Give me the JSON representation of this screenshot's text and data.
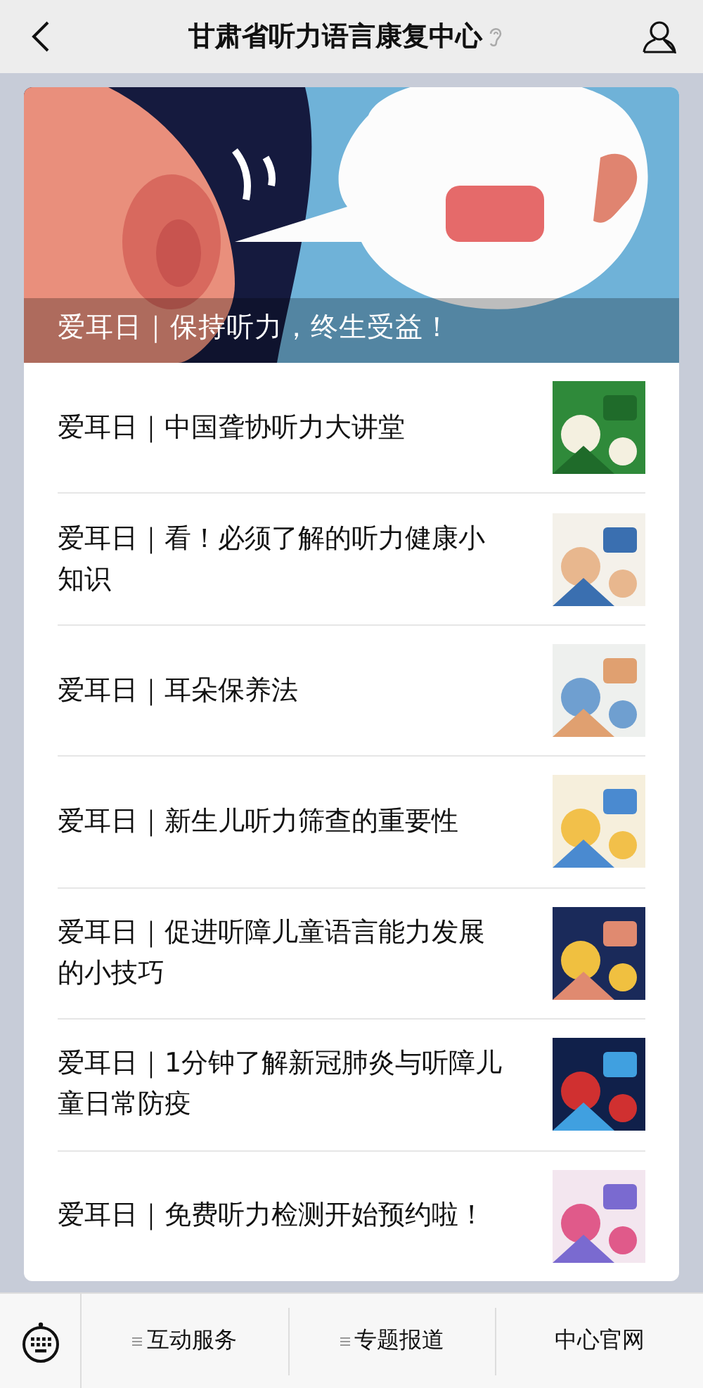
{
  "header": {
    "title": "甘肃省听力语言康复中心"
  },
  "banner": {
    "caption": "爱耳日｜保持听力，终生受益！"
  },
  "articles": [
    {
      "title": "爱耳日｜中国聋协听力大讲堂"
    },
    {
      "title": "爱耳日｜看！必须了解的听力健康小知识"
    },
    {
      "title": "爱耳日｜耳朵保养法"
    },
    {
      "title": "爱耳日｜新生儿听力筛查的重要性"
    },
    {
      "title": "爱耳日｜促进听障儿童语言能力发展的小技巧"
    },
    {
      "title": "爱耳日｜1分钟了解新冠肺炎与听障儿童日常防疫"
    },
    {
      "title": "爱耳日｜免费听力检测开始预约啦！"
    }
  ],
  "menu": [
    {
      "label": "互动服务",
      "has_submenu": true
    },
    {
      "label": "专题报道",
      "has_submenu": true
    },
    {
      "label": "中心官网",
      "has_submenu": false
    }
  ]
}
